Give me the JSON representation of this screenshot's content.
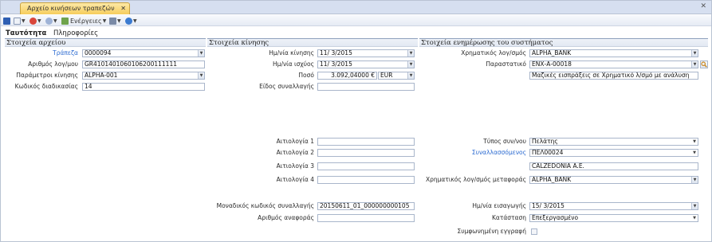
{
  "window": {
    "tab_title": "Αρχείο κινήσεων τραπεζών",
    "tab_close": "✕",
    "close": "✕"
  },
  "toolbar": {
    "actions_label": "Ενέργειες"
  },
  "tabs": [
    {
      "label": "Ταυτότητα"
    },
    {
      "label": "Πληροφορίες"
    }
  ],
  "sections": {
    "file": "Στοιχεία αρχείου",
    "movement": "Στοιχεία κίνησης",
    "system": "Στοιχεία ενημέρωσης του συστήματος"
  },
  "file_info": {
    "bank_label": "Τράπεζα",
    "bank_value": "0000094",
    "account_label": "Αριθμός λογ/μου",
    "account_value": "GR4101401060106200111111",
    "params_label": "Παράμετροι κίνησης",
    "params_value": "ALPHA-001",
    "proc_label": "Κωδικός διαδικασίας",
    "proc_value": "14"
  },
  "movement": {
    "mov_date_label": "Ημ/νία κίνησης",
    "mov_date_value": "11/ 3/2015",
    "val_date_label": "Ημ/νία ισχύος",
    "val_date_value": "11/ 3/2015",
    "amount_label": "Ποσό",
    "amount_value": "3.092,04000 €",
    "currency_value": "EUR",
    "trx_type_label": "Είδος συναλλαγής",
    "trx_type_value": "",
    "reason1_label": "Αιτιολογία 1",
    "reason2_label": "Αιτιολογία 2",
    "reason3_label": "Αιτιολογία 3",
    "reason4_label": "Αιτιολογία 4",
    "reason1_value": "",
    "reason2_value": "",
    "reason3_value": "",
    "reason4_value": "",
    "uid_label": "Μοναδικός κωδικός συναλλαγής",
    "uid_value": "20150611_01_000000000105",
    "ref_label": "Αριθμός αναφοράς",
    "ref_value": ""
  },
  "system": {
    "fin_acct_label": "Χρηματικός λογ/σμός",
    "fin_acct_value": "ALPHA_BANK",
    "doc_label": "Παραστατικό",
    "doc_value": "ΕΝΧ-Α-00018",
    "doc_desc_value": "Μαζικές εισπράξεις σε Χρηματικό λ/σμό με ανάλυση",
    "party_type_label": "Τύπος συν/νου",
    "party_type_value": "Πελάτης",
    "party_label": "Συναλλασσόμενος",
    "party_value": "ΠΕΛ00024",
    "party_name_value": "CALZEDONIA A.E.",
    "transfer_acct_label": "Χρηματικός λογ/σμός μεταφοράς",
    "transfer_acct_value": "ALPHA_BANK",
    "import_date_label": "Ημ/νία εισαγωγής",
    "import_date_value": "15/ 3/2015",
    "status_label": "Κατάσταση",
    "status_value": "Επεξεργασμένο",
    "reconciled_label": "Συμφωνημένη εγγραφή"
  },
  "colors": {
    "accent": "#2c6bd1",
    "tab_active": "#f6cd5d",
    "section_border": "#8fa1bd"
  }
}
